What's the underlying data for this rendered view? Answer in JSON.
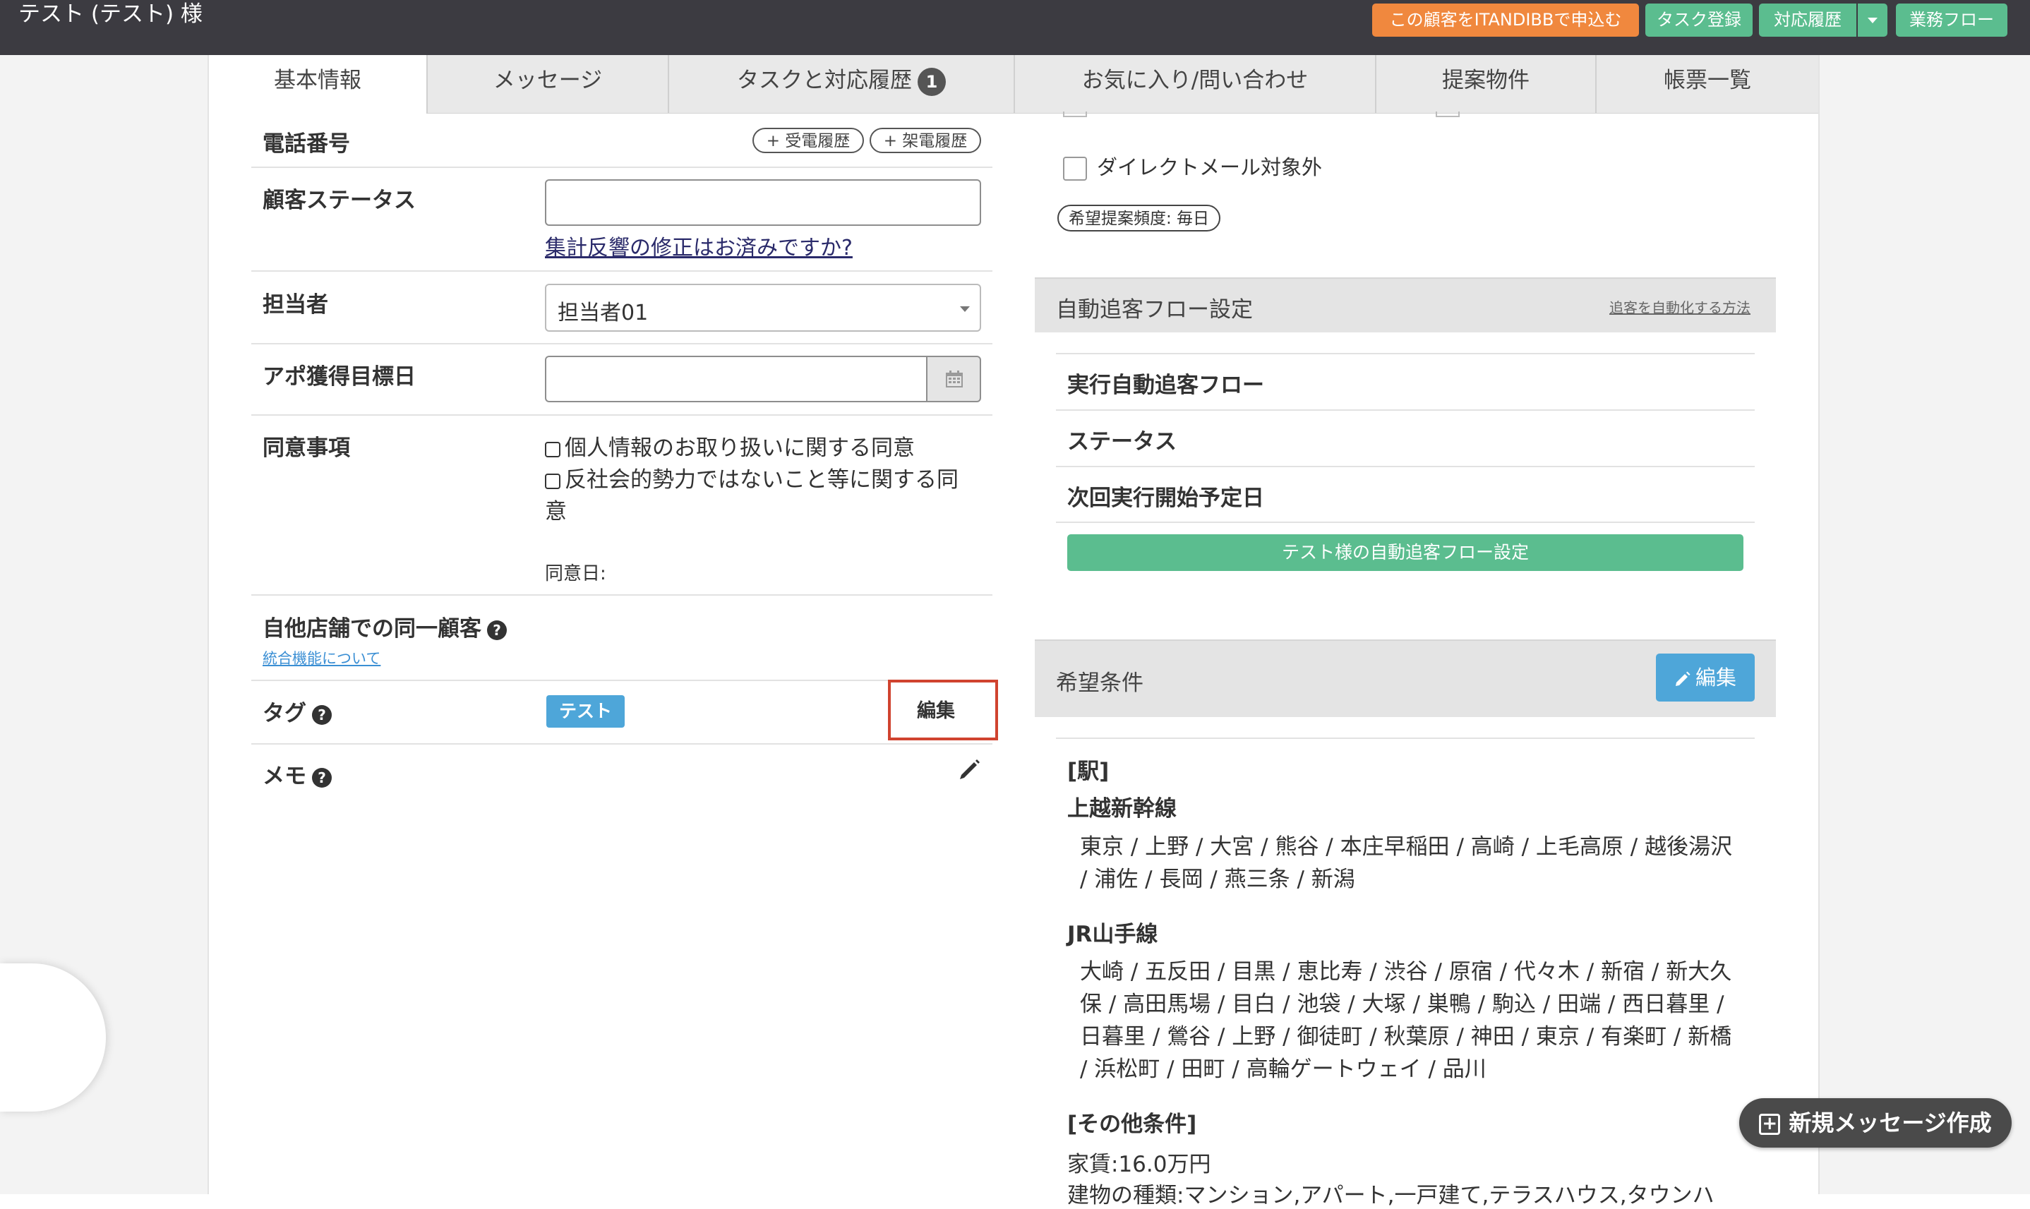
{
  "header": {
    "title": "テスト (テスト) 様",
    "buttons": {
      "itandi": "この顧客をITANDIBBで申込む",
      "task_register": "タスク登録",
      "history": "対応履歴",
      "workflow": "業務フロー"
    },
    "colors": {
      "orange": "#f0883e",
      "green": "#5bbd8f",
      "bar": "#3c3b41"
    }
  },
  "tabs": [
    {
      "label": "基本情報",
      "active": true
    },
    {
      "label": "メッセージ"
    },
    {
      "label": "タスクと対応履歴",
      "badge": "1"
    },
    {
      "label": "お気に入り/問い合わせ"
    },
    {
      "label": "提案物件"
    },
    {
      "label": "帳票一覧"
    }
  ],
  "left": {
    "phone": {
      "label": "電話番号",
      "incoming_btn": "+ 受電履歴",
      "outgoing_btn": "+ 架電履歴"
    },
    "status": {
      "label": "顧客ステータス",
      "value": "",
      "link": "集計反響の修正はお済みですか?"
    },
    "assignee": {
      "label": "担当者",
      "value": "担当者01"
    },
    "appointment": {
      "label": "アポ獲得目標日",
      "value": ""
    },
    "consent": {
      "label": "同意事項",
      "item1": "個人情報のお取り扱いに関する同意",
      "item2_line1": "反社会的勢力ではないこと等に関する同",
      "item2_line2": "意",
      "date_label": "同意日:"
    },
    "same_customer": {
      "label": "自他店舗での同一顧客",
      "link": "統合機能について"
    },
    "tag": {
      "label": "タグ",
      "chip": "テスト",
      "edit": "編集"
    },
    "memo": {
      "label": "メモ"
    }
  },
  "right": {
    "dm_exclude": "ダイレクトメール対象外",
    "frequency": "希望提案頻度: 毎日",
    "auto_flow": {
      "title": "自動追客フロー設定",
      "howto": "追客を自動化する方法",
      "row1": "実行自動追客フロー",
      "row2": "ステータス",
      "row3": "次回実行開始予定日",
      "button": "テスト様の自動追客フロー設定"
    },
    "conditions": {
      "title": "希望条件",
      "edit": "編集",
      "station_header": "[駅]",
      "line1_name": "上越新幹線",
      "line1_stations_a": "東京 / 上野 / 大宮 / 熊谷 / 本庄早稲田 / 高崎 / 上毛高原 / 越後湯沢",
      "line1_stations_b": "/ 浦佐 / 長岡 / 燕三条 / 新潟",
      "line2_name": "JR山手線",
      "line2_stations_a": "大崎 / 五反田 / 目黒 / 恵比寿 / 渋谷 / 原宿 / 代々木 / 新宿 / 新大久",
      "line2_stations_b": "保 / 高田馬場 / 目白 / 池袋 / 大塚 / 巣鴨 / 駒込 / 田端 / 西日暮里 /",
      "line2_stations_c": "日暮里 / 鶯谷 / 上野 / 御徒町 / 秋葉原 / 神田 / 東京 / 有楽町 / 新橋",
      "line2_stations_d": "/ 浜松町 / 田町 / 高輪ゲートウェイ / 品川",
      "other_header": "[その他条件]",
      "rent": "家賃:16.0万円",
      "building": "建物の種類:マンション,アパート,一戸建て,テラスハウス,タウンハ"
    }
  },
  "fab": {
    "label": "新規メッセージ作成"
  }
}
